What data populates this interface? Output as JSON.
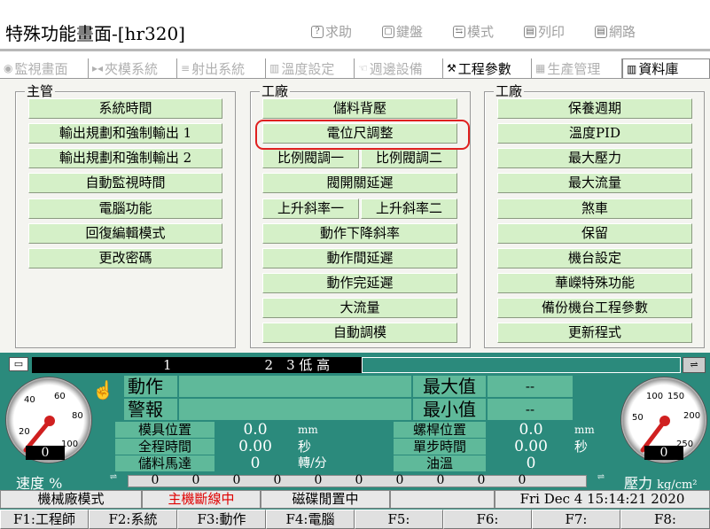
{
  "window": {
    "title": "特殊功能畫面-[hr320]"
  },
  "topbar": [
    {
      "icon": "help-icon",
      "glyph": "?",
      "label": "求助"
    },
    {
      "icon": "keyboard-icon",
      "glyph": "▢",
      "label": "鍵盤"
    },
    {
      "icon": "mode-icon",
      "glyph": "⇆",
      "label": "模式"
    },
    {
      "icon": "printer-icon",
      "glyph": "▤",
      "label": "列印"
    },
    {
      "icon": "network-icon",
      "glyph": "▤",
      "label": "網路"
    }
  ],
  "tabs": [
    {
      "label": "監視畫面",
      "icon": "eye-icon",
      "glyph": "◉"
    },
    {
      "label": "夾模系統",
      "icon": "clamp-icon",
      "glyph": "▸◂"
    },
    {
      "label": "射出系統",
      "icon": "injection-icon",
      "glyph": "≡"
    },
    {
      "label": "溫度設定",
      "icon": "temperature-icon",
      "glyph": "▥"
    },
    {
      "label": "週邊設備",
      "icon": "peripheral-icon",
      "glyph": "☜"
    },
    {
      "label": "工程參數",
      "icon": "wrench-icon",
      "glyph": "🔧"
    },
    {
      "label": "生產管理",
      "icon": "production-icon",
      "glyph": "▦"
    },
    {
      "label": "資料庫",
      "icon": "database-icon",
      "glyph": "▥"
    }
  ],
  "groups": {
    "manager": {
      "title": "主管",
      "buttons": [
        "系統時間",
        "輸出規劃和強制輸出 1",
        "輸出規劃和強制輸出 2",
        "自動監視時間",
        "電腦功能",
        "回復編輯模式",
        "更改密碼"
      ]
    },
    "factory1": {
      "title": "工廠",
      "buttons": [
        "儲料背壓",
        "電位尺調整",
        "比例閥調一",
        "比例閥調二",
        "閥開關延遲",
        "上升斜率一",
        "上升斜率二",
        "動作下降斜率",
        "動作間延遲",
        "動作完延遲",
        "大流量",
        "自動調模"
      ]
    },
    "factory2": {
      "title": "工廠",
      "buttons": [
        "保養週期",
        "溫度PID",
        "最大壓力",
        "最大流量",
        "煞車",
        "保留",
        "機台設定",
        "華嶸特殊功能",
        "備份機台工程參數",
        "更新程式"
      ]
    }
  },
  "indicator": {
    "text": "1　　　　　　　2　3 低 高"
  },
  "monitor": {
    "action_label": "動作",
    "alarm_label": "警報",
    "max_label": "最大值",
    "min_label": "最小值",
    "max_value": "--",
    "min_value": "--",
    "rows": [
      {
        "label": "模具位置",
        "value": "0.0",
        "unit": "mm",
        "label2": "螺桿位置",
        "value2": "0.0",
        "unit2": "mm"
      },
      {
        "label": "全程時間",
        "value": "0.00",
        "unit": "秒",
        "label2": "單步時間",
        "value2": "0.00",
        "unit2": "秒"
      },
      {
        "label": "儲料馬達",
        "value": "0",
        "unit": "轉/分",
        "label2": "油溫",
        "value2": "0",
        "unit2": ""
      }
    ]
  },
  "gauges": {
    "speed": {
      "ticks": [
        "20",
        "40",
        "60",
        "80",
        "100"
      ],
      "value": "0",
      "label": "速度",
      "unit": "%"
    },
    "pressure": {
      "ticks": [
        "50",
        "100",
        "150",
        "200",
        "250"
      ],
      "value": "0",
      "label": "壓力",
      "unit": "kg/cm²"
    }
  },
  "sliders": [
    "0",
    "0",
    "0",
    "0",
    "0",
    "0",
    "0",
    "0",
    "0",
    "0"
  ],
  "status": {
    "mode": "機械廠模式",
    "host": "主機斷線中",
    "disk": "磁碟閒置中",
    "datetime": "Fri Dec  4 15:14:21 2020"
  },
  "fkeys": [
    "F1:工程師",
    "F2:系統",
    "F3:動作",
    "F4:電腦",
    "F5:",
    "F6:",
    "F7:",
    "F8:"
  ],
  "colors": {
    "button_bg": "#d5f0c8",
    "panel_bg": "#2b8a7c",
    "highlight": "#e02020",
    "host_status": "#e00000"
  }
}
